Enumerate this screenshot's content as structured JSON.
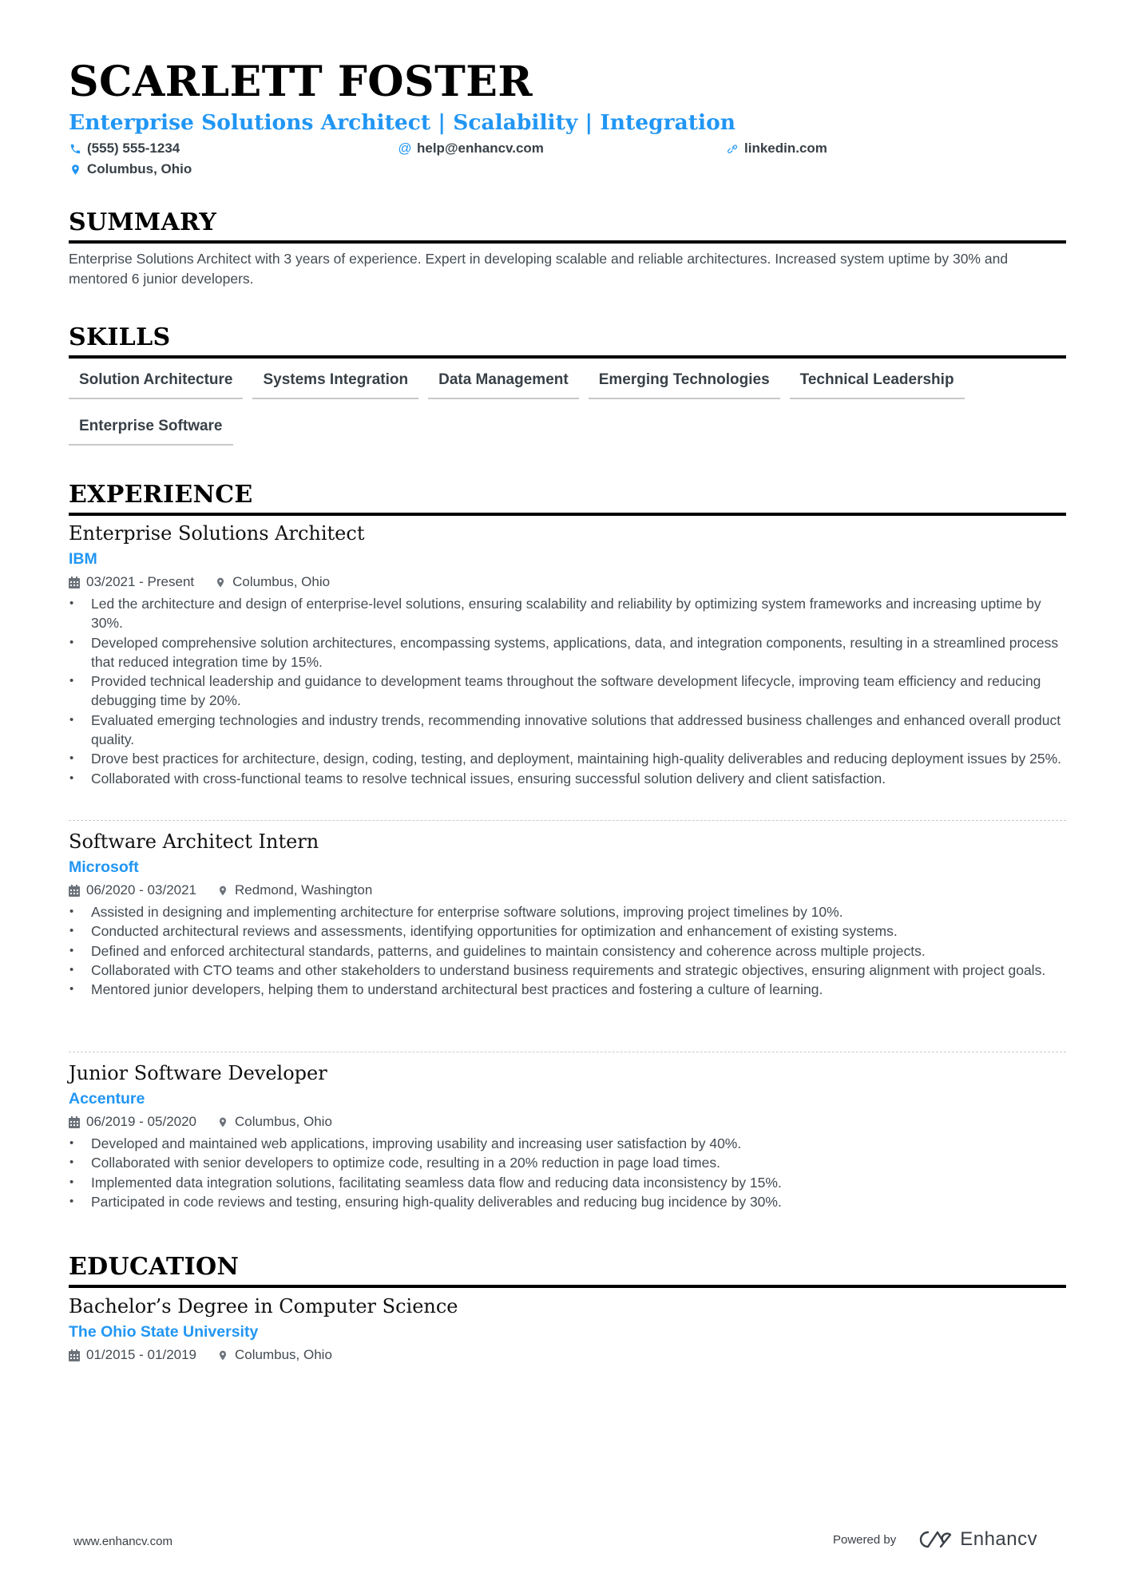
{
  "header": {
    "name": "SCARLETT FOSTER",
    "headline": "Enterprise Solutions Architect | Scalability | Integration",
    "contacts": {
      "phone": {
        "icon": "phone-icon",
        "value": "(555) 555-1234"
      },
      "email": {
        "icon": "at-icon",
        "value": "help@enhancv.com"
      },
      "linkedin": {
        "icon": "link-icon",
        "value": "linkedin.com"
      },
      "location": {
        "icon": "map-pin-icon",
        "value": "Columbus, Ohio"
      }
    }
  },
  "summary": {
    "title": "SUMMARY",
    "text": "Enterprise Solutions Architect with 3 years of experience. Expert in developing scalable and reliable architectures. Increased system uptime by 30% and mentored 6 junior developers."
  },
  "skills": {
    "title": "SKILLS",
    "items": [
      "Solution Architecture",
      "Systems Integration",
      "Data Management",
      "Emerging Technologies",
      "Technical Leadership",
      "Enterprise Software"
    ]
  },
  "experience": {
    "title": "EXPERIENCE",
    "jobs": [
      {
        "role": "Enterprise Solutions Architect",
        "company": "IBM",
        "dates": "03/2021 - Present",
        "location": "Columbus, Ohio",
        "bullets": [
          "Led the architecture and design of enterprise-level solutions, ensuring scalability and reliability by optimizing system frameworks and increasing uptime by 30%.",
          "Developed comprehensive solution architectures, encompassing systems, applications, data, and integration components, resulting in a streamlined process that reduced integration time by 15%.",
          "Provided technical leadership and guidance to development teams throughout the software development lifecycle, improving team efficiency and reducing debugging time by 20%.",
          "Evaluated emerging technologies and industry trends, recommending innovative solutions that addressed business challenges and enhanced overall product quality.",
          "Drove best practices for architecture, design, coding, testing, and deployment, maintaining high-quality deliverables and reducing deployment issues by 25%.",
          "Collaborated with cross-functional teams to resolve technical issues, ensuring successful solution delivery and client satisfaction."
        ]
      },
      {
        "role": "Software Architect Intern",
        "company": "Microsoft",
        "dates": "06/2020 - 03/2021",
        "location": "Redmond, Washington",
        "bullets": [
          "Assisted in designing and implementing architecture for enterprise software solutions, improving project timelines by 10%.",
          "Conducted architectural reviews and assessments, identifying opportunities for optimization and enhancement of existing systems.",
          "Defined and enforced architectural standards, patterns, and guidelines to maintain consistency and coherence across multiple projects.",
          "Collaborated with CTO teams and other stakeholders to understand business requirements and strategic objectives, ensuring alignment with project goals.",
          "Mentored junior developers, helping them to understand architectural best practices and fostering a culture of learning."
        ]
      },
      {
        "role": "Junior Software Developer",
        "company": "Accenture",
        "dates": "06/2019 - 05/2020",
        "location": "Columbus, Ohio",
        "bullets": [
          "Developed and maintained web applications, improving usability and increasing user satisfaction by 40%.",
          "Collaborated with senior developers to optimize code, resulting in a 20% reduction in page load times.",
          "Implemented data integration solutions, facilitating seamless data flow and reducing data inconsistency by 15%.",
          "Participated in code reviews and testing, ensuring high-quality deliverables and reducing bug incidence by 30%."
        ]
      }
    ]
  },
  "education": {
    "title": "EDUCATION",
    "items": [
      {
        "degree": "Bachelor’s Degree in Computer Science",
        "school": "The Ohio State University",
        "dates": "01/2015 - 01/2019",
        "location": "Columbus, Ohio"
      }
    ]
  },
  "footer": {
    "website": "www.enhancv.com",
    "powered_by": "Powered by",
    "brand": "Enhancv",
    "brand_icon": "enhancv-logo-icon"
  },
  "colors": {
    "accent": "#2196f3",
    "text": "#444b52",
    "heading": "#000000"
  }
}
